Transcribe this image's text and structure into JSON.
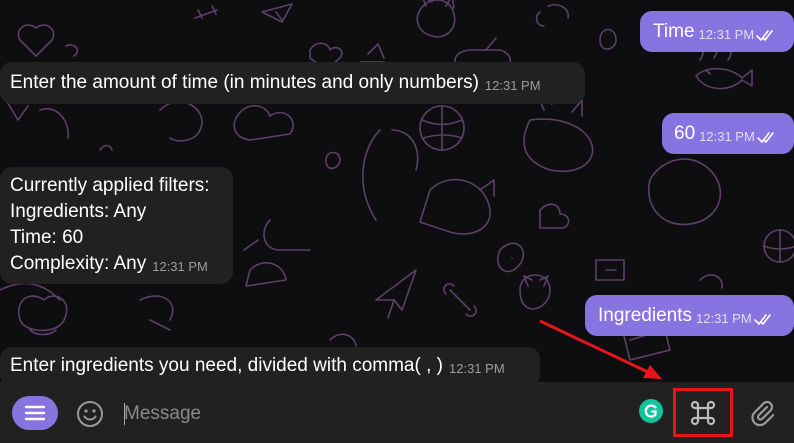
{
  "chat": {
    "messages": [
      {
        "direction": "outgoing",
        "text": "Time",
        "time": "12:31 PM",
        "read": true
      },
      {
        "direction": "incoming",
        "text": "Enter the amount of time (in minutes and only numbers)",
        "time": "12:31 PM"
      },
      {
        "direction": "outgoing",
        "text": "60",
        "time": "12:31 PM",
        "read": true
      },
      {
        "direction": "incoming",
        "lines": [
          "Currently applied filters:",
          "Ingredients: Any",
          "Time: 60",
          "Complexity: Any"
        ],
        "time": "12:31 PM"
      },
      {
        "direction": "outgoing",
        "text": "Ingredients",
        "time": "12:31 PM",
        "read": true
      },
      {
        "direction": "incoming",
        "text": "Enter ingredients you need, divided with comma( , )",
        "time": "12:31 PM"
      }
    ]
  },
  "composer": {
    "placeholder": "Message"
  },
  "icons": {
    "menu": "menu-icon",
    "emoji": "emoji-icon",
    "grammarly": "grammarly-icon",
    "bot_commands": "command-icon",
    "attach": "paperclip-icon",
    "read_status": "double-check-icon"
  },
  "colors": {
    "accent": "#8774e1",
    "incoming_bubble": "#212121",
    "highlight": "#e8141b",
    "grammarly": "#15c39a"
  }
}
